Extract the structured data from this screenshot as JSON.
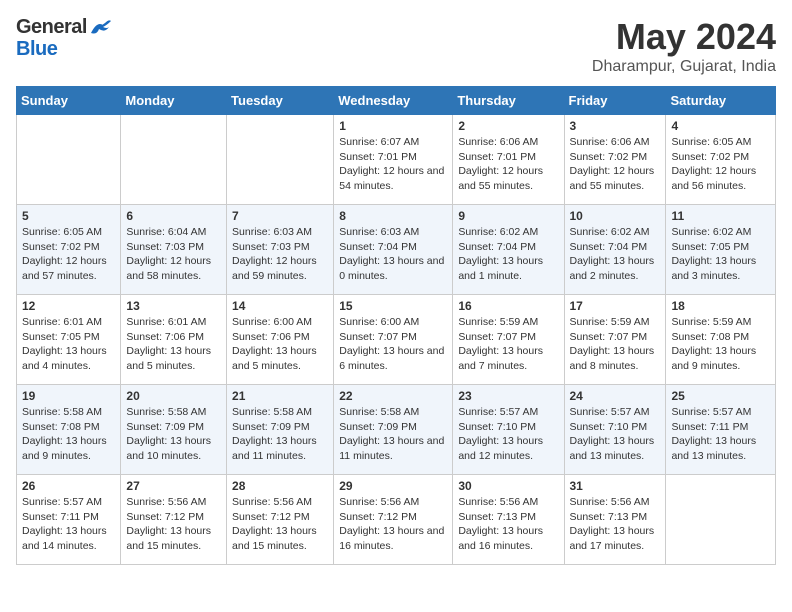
{
  "header": {
    "logo_general": "General",
    "logo_blue": "Blue",
    "month": "May 2024",
    "location": "Dharampur, Gujarat, India"
  },
  "days_of_week": [
    "Sunday",
    "Monday",
    "Tuesday",
    "Wednesday",
    "Thursday",
    "Friday",
    "Saturday"
  ],
  "weeks": [
    [
      {
        "num": "",
        "sunrise": "",
        "sunset": "",
        "daylight": ""
      },
      {
        "num": "",
        "sunrise": "",
        "sunset": "",
        "daylight": ""
      },
      {
        "num": "",
        "sunrise": "",
        "sunset": "",
        "daylight": ""
      },
      {
        "num": "1",
        "sunrise": "Sunrise: 6:07 AM",
        "sunset": "Sunset: 7:01 PM",
        "daylight": "Daylight: 12 hours and 54 minutes."
      },
      {
        "num": "2",
        "sunrise": "Sunrise: 6:06 AM",
        "sunset": "Sunset: 7:01 PM",
        "daylight": "Daylight: 12 hours and 55 minutes."
      },
      {
        "num": "3",
        "sunrise": "Sunrise: 6:06 AM",
        "sunset": "Sunset: 7:02 PM",
        "daylight": "Daylight: 12 hours and 55 minutes."
      },
      {
        "num": "4",
        "sunrise": "Sunrise: 6:05 AM",
        "sunset": "Sunset: 7:02 PM",
        "daylight": "Daylight: 12 hours and 56 minutes."
      }
    ],
    [
      {
        "num": "5",
        "sunrise": "Sunrise: 6:05 AM",
        "sunset": "Sunset: 7:02 PM",
        "daylight": "Daylight: 12 hours and 57 minutes."
      },
      {
        "num": "6",
        "sunrise": "Sunrise: 6:04 AM",
        "sunset": "Sunset: 7:03 PM",
        "daylight": "Daylight: 12 hours and 58 minutes."
      },
      {
        "num": "7",
        "sunrise": "Sunrise: 6:03 AM",
        "sunset": "Sunset: 7:03 PM",
        "daylight": "Daylight: 12 hours and 59 minutes."
      },
      {
        "num": "8",
        "sunrise": "Sunrise: 6:03 AM",
        "sunset": "Sunset: 7:04 PM",
        "daylight": "Daylight: 13 hours and 0 minutes."
      },
      {
        "num": "9",
        "sunrise": "Sunrise: 6:02 AM",
        "sunset": "Sunset: 7:04 PM",
        "daylight": "Daylight: 13 hours and 1 minute."
      },
      {
        "num": "10",
        "sunrise": "Sunrise: 6:02 AM",
        "sunset": "Sunset: 7:04 PM",
        "daylight": "Daylight: 13 hours and 2 minutes."
      },
      {
        "num": "11",
        "sunrise": "Sunrise: 6:02 AM",
        "sunset": "Sunset: 7:05 PM",
        "daylight": "Daylight: 13 hours and 3 minutes."
      }
    ],
    [
      {
        "num": "12",
        "sunrise": "Sunrise: 6:01 AM",
        "sunset": "Sunset: 7:05 PM",
        "daylight": "Daylight: 13 hours and 4 minutes."
      },
      {
        "num": "13",
        "sunrise": "Sunrise: 6:01 AM",
        "sunset": "Sunset: 7:06 PM",
        "daylight": "Daylight: 13 hours and 5 minutes."
      },
      {
        "num": "14",
        "sunrise": "Sunrise: 6:00 AM",
        "sunset": "Sunset: 7:06 PM",
        "daylight": "Daylight: 13 hours and 5 minutes."
      },
      {
        "num": "15",
        "sunrise": "Sunrise: 6:00 AM",
        "sunset": "Sunset: 7:07 PM",
        "daylight": "Daylight: 13 hours and 6 minutes."
      },
      {
        "num": "16",
        "sunrise": "Sunrise: 5:59 AM",
        "sunset": "Sunset: 7:07 PM",
        "daylight": "Daylight: 13 hours and 7 minutes."
      },
      {
        "num": "17",
        "sunrise": "Sunrise: 5:59 AM",
        "sunset": "Sunset: 7:07 PM",
        "daylight": "Daylight: 13 hours and 8 minutes."
      },
      {
        "num": "18",
        "sunrise": "Sunrise: 5:59 AM",
        "sunset": "Sunset: 7:08 PM",
        "daylight": "Daylight: 13 hours and 9 minutes."
      }
    ],
    [
      {
        "num": "19",
        "sunrise": "Sunrise: 5:58 AM",
        "sunset": "Sunset: 7:08 PM",
        "daylight": "Daylight: 13 hours and 9 minutes."
      },
      {
        "num": "20",
        "sunrise": "Sunrise: 5:58 AM",
        "sunset": "Sunset: 7:09 PM",
        "daylight": "Daylight: 13 hours and 10 minutes."
      },
      {
        "num": "21",
        "sunrise": "Sunrise: 5:58 AM",
        "sunset": "Sunset: 7:09 PM",
        "daylight": "Daylight: 13 hours and 11 minutes."
      },
      {
        "num": "22",
        "sunrise": "Sunrise: 5:58 AM",
        "sunset": "Sunset: 7:09 PM",
        "daylight": "Daylight: 13 hours and 11 minutes."
      },
      {
        "num": "23",
        "sunrise": "Sunrise: 5:57 AM",
        "sunset": "Sunset: 7:10 PM",
        "daylight": "Daylight: 13 hours and 12 minutes."
      },
      {
        "num": "24",
        "sunrise": "Sunrise: 5:57 AM",
        "sunset": "Sunset: 7:10 PM",
        "daylight": "Daylight: 13 hours and 13 minutes."
      },
      {
        "num": "25",
        "sunrise": "Sunrise: 5:57 AM",
        "sunset": "Sunset: 7:11 PM",
        "daylight": "Daylight: 13 hours and 13 minutes."
      }
    ],
    [
      {
        "num": "26",
        "sunrise": "Sunrise: 5:57 AM",
        "sunset": "Sunset: 7:11 PM",
        "daylight": "Daylight: 13 hours and 14 minutes."
      },
      {
        "num": "27",
        "sunrise": "Sunrise: 5:56 AM",
        "sunset": "Sunset: 7:12 PM",
        "daylight": "Daylight: 13 hours and 15 minutes."
      },
      {
        "num": "28",
        "sunrise": "Sunrise: 5:56 AM",
        "sunset": "Sunset: 7:12 PM",
        "daylight": "Daylight: 13 hours and 15 minutes."
      },
      {
        "num": "29",
        "sunrise": "Sunrise: 5:56 AM",
        "sunset": "Sunset: 7:12 PM",
        "daylight": "Daylight: 13 hours and 16 minutes."
      },
      {
        "num": "30",
        "sunrise": "Sunrise: 5:56 AM",
        "sunset": "Sunset: 7:13 PM",
        "daylight": "Daylight: 13 hours and 16 minutes."
      },
      {
        "num": "31",
        "sunrise": "Sunrise: 5:56 AM",
        "sunset": "Sunset: 7:13 PM",
        "daylight": "Daylight: 13 hours and 17 minutes."
      },
      {
        "num": "",
        "sunrise": "",
        "sunset": "",
        "daylight": ""
      }
    ]
  ]
}
